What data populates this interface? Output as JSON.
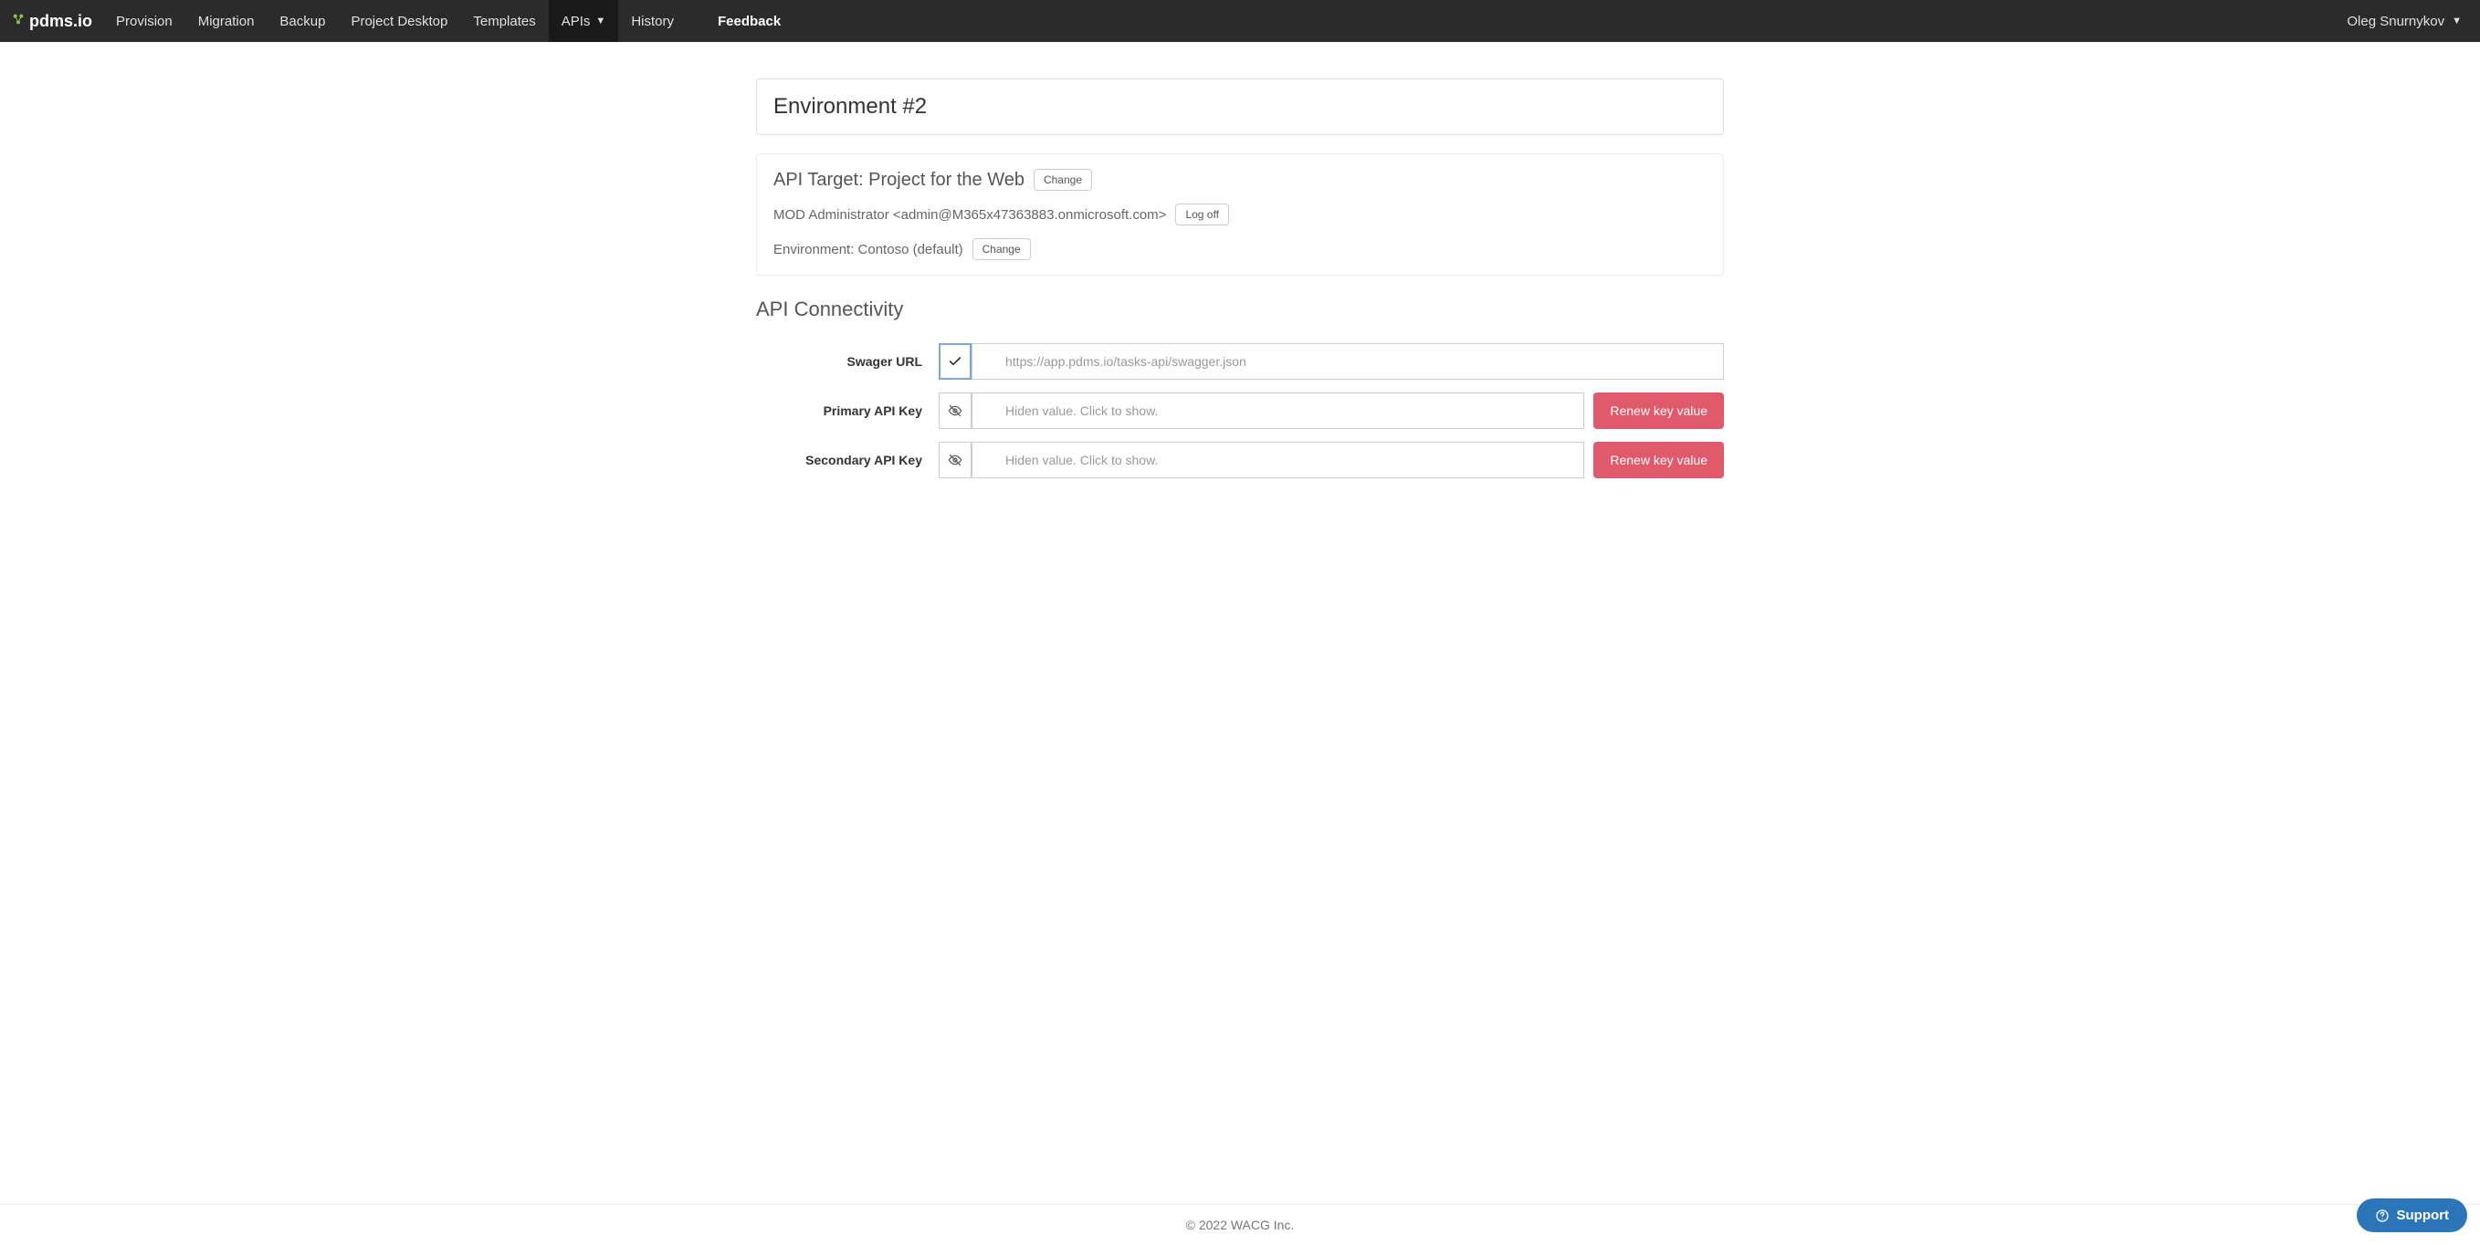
{
  "brand": {
    "text": "pdms.io"
  },
  "nav": {
    "items": [
      {
        "label": "Provision"
      },
      {
        "label": "Migration"
      },
      {
        "label": "Backup"
      },
      {
        "label": "Project Desktop"
      },
      {
        "label": "Templates"
      },
      {
        "label": "APIs",
        "dropdown": true,
        "active": true
      },
      {
        "label": "History"
      }
    ],
    "feedback": "Feedback"
  },
  "user": {
    "name": "Oleg Snurnykov"
  },
  "page": {
    "title": "Environment #2",
    "target_label": "API Target: Project for the Web",
    "target_change": "Change",
    "admin_line": "MOD Administrator <admin@M365x47363883.onmicrosoft.com>",
    "logoff": "Log off",
    "env_line": "Environment: Contoso (default)",
    "env_change": "Change",
    "connectivity_title": "API Connectivity",
    "fields": {
      "swagger": {
        "label": "Swager URL",
        "value": "https://app.pdms.io/tasks-api/swagger.json"
      },
      "primary": {
        "label": "Primary API Key",
        "placeholder": "Hiden value. Click to show.",
        "renew": "Renew key value"
      },
      "secondary": {
        "label": "Secondary API Key",
        "placeholder": "Hiden value. Click to show.",
        "renew": "Renew key value"
      }
    }
  },
  "footer": {
    "text": "© 2022 WACG Inc."
  },
  "support": {
    "label": "Support"
  }
}
